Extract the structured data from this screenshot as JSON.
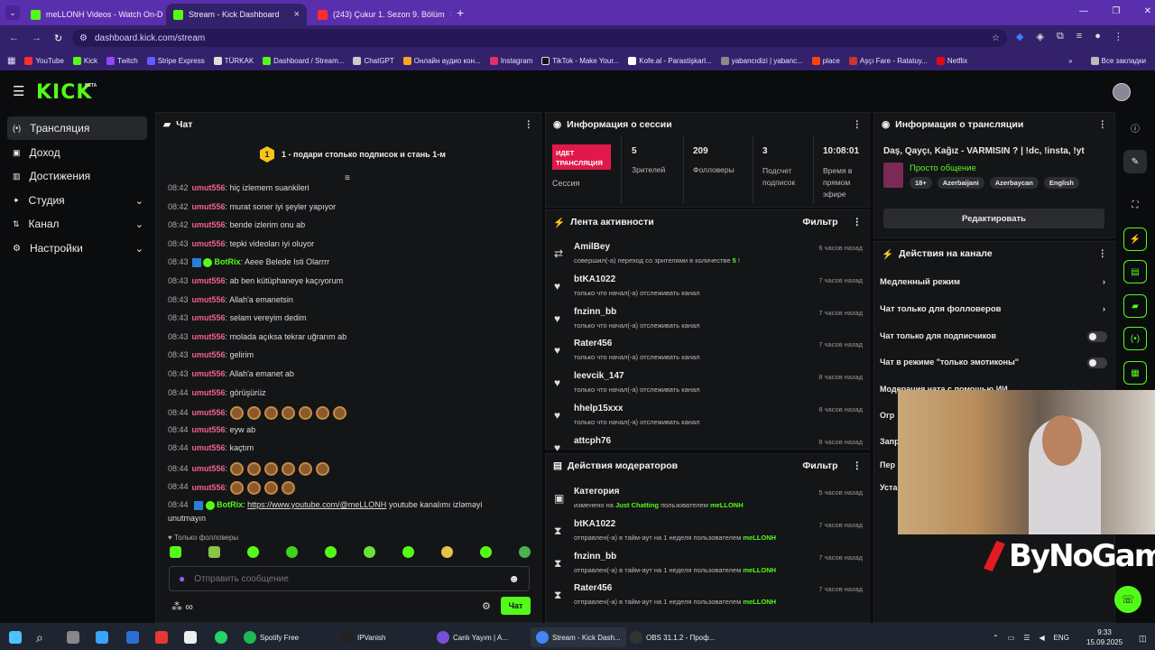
{
  "browser": {
    "tabs": [
      {
        "title": "meLLONH Videos - Watch On-D"
      },
      {
        "title": "Stream - Kick Dashboard"
      },
      {
        "title": "(243) Çukur 1. Sezon 9. Bölüm"
      }
    ],
    "url": "dashboard.kick.com/stream",
    "bookmarks": [
      "YouTube",
      "Kick",
      "Twitch",
      "Stripe Express",
      "TÜRKAK",
      "Dashboard / Stream...",
      "ChatGPT",
      "Онлайн аудио кон...",
      "Instagram",
      "TikTok - Make Your...",
      "Kofe.al - Parastişkarl...",
      "yabancıdizi | yabanc...",
      "place",
      "Aşçı Fare - Ratatuy...",
      "Netflix"
    ],
    "all_bookmarks": "Все закладки"
  },
  "kick": {
    "logo": "KICK",
    "beta": "BETA",
    "sidebar": [
      {
        "label": "Трансляция"
      },
      {
        "label": "Доход"
      },
      {
        "label": "Достижения"
      },
      {
        "label": "Студия"
      },
      {
        "label": "Канал"
      },
      {
        "label": "Настройки"
      }
    ]
  },
  "chat": {
    "title": "Чат",
    "pinned_rank": "1",
    "pinned": "1 - подари столько подписок и стань 1-м",
    "lines": [
      {
        "time": "08:42",
        "user": "umut556",
        "msg": "hiç izlemem suankileri"
      },
      {
        "time": "08:42",
        "user": "umut556",
        "msg": "murat soner iyi şeyler yapıyor"
      },
      {
        "time": "08:42",
        "user": "umut556",
        "msg": "bende izlerim onu ab"
      },
      {
        "time": "08:43",
        "user": "umut556",
        "msg": "tepki videoları iyi oluyor"
      },
      {
        "time": "08:43",
        "user": "BotRix",
        "msg": "Aeee Belede Isti Olarrrr"
      },
      {
        "time": "08:43",
        "user": "umut556",
        "msg": "ab ben kütüphaneye kaçıyorum"
      },
      {
        "time": "08:43",
        "user": "umut556",
        "msg": "Allah'a emanetsin"
      },
      {
        "time": "08:43",
        "user": "umut556",
        "msg": "selam vereyim dedim"
      },
      {
        "time": "08:43",
        "user": "umut556",
        "msg": "molada açıksa tekrar uğrarım ab"
      },
      {
        "time": "08:43",
        "user": "umut556",
        "msg": "gelirim"
      },
      {
        "time": "08:43",
        "user": "umut556",
        "msg": "Allah'a emanet ab"
      },
      {
        "time": "08:44",
        "user": "umut556",
        "msg": "görüşürüz"
      },
      {
        "time": "08:44",
        "user": "umut556",
        "msg": ""
      },
      {
        "time": "08:44",
        "user": "umut556",
        "msg": "eyw ab"
      },
      {
        "time": "08:44",
        "user": "umut556",
        "msg": "kaçtım"
      },
      {
        "time": "08:44",
        "user": "umut556",
        "msg": ""
      },
      {
        "time": "08:44",
        "user": "umut556",
        "msg": ""
      }
    ],
    "last_time": "08:44",
    "last_user": "BotRix",
    "last_link": "https://www.youtube.com/@meLLONH",
    "last_msg": "youtube kanalımı izləməyi",
    "last_msg2": "unutmayın",
    "followers_only": "Только фолловеры",
    "input_placeholder": "Отправить сообщение",
    "send": "Чат"
  },
  "session": {
    "title": "Информация о сессии",
    "live": "ИДЕТ ТРАНСЛЯЦИЯ",
    "session_label": "Сессия",
    "viewers": "5",
    "viewers_label": "Зрителей",
    "followers": "209",
    "followers_label": "Фолловеры",
    "subs": "3",
    "subs_label": "Подсчет подписок",
    "uptime": "10:08:01",
    "uptime_label": "Время в прямом эфире"
  },
  "activity": {
    "title": "Лента активности",
    "filter": "Фильтр",
    "items": [
      {
        "name": "AmilBey",
        "desc": "совершил(-а) переход со зрителями в количестве",
        "num": "5",
        "time": "6 часов назад",
        "icon": "raid"
      },
      {
        "name": "btKA1022",
        "desc": "только что начал(-а) отслеживать канал",
        "time": "7 часов назад",
        "icon": "heart"
      },
      {
        "name": "fnzinn_bb",
        "desc": "только что начал(-а) отслеживать канал",
        "time": "7 часов назад",
        "icon": "heart"
      },
      {
        "name": "Rater456",
        "desc": "только что начал(-а) отслеживать канал",
        "time": "7 часов назад",
        "icon": "heart"
      },
      {
        "name": "leevcik_147",
        "desc": "только что начал(-а) отслеживать канал",
        "time": "8 часов назад",
        "icon": "heart"
      },
      {
        "name": "hhelp15xxx",
        "desc": "только что начал(-а) отслеживать канал",
        "time": "8 часов назад",
        "icon": "heart"
      },
      {
        "name": "attcph76",
        "desc": "",
        "time": "8 часов назад",
        "icon": "heart"
      }
    ]
  },
  "mod": {
    "title": "Действия модераторов",
    "filter": "Фильтр",
    "items": [
      {
        "name": "Категория",
        "pre": "изменено на",
        "cat": "Just Chatting",
        "mid": "пользователем",
        "by": "meLLONH",
        "time": "5 часов назад"
      },
      {
        "name": "btKA1022",
        "pre": "отправлен(-а) в тайм-аут на 1 неделя пользователем",
        "by": "meLLONH",
        "time": "7 часов назад"
      },
      {
        "name": "fnzinn_bb",
        "pre": "отправлен(-а) в тайм-аут на 1 неделя пользователем",
        "by": "meLLONH",
        "time": "7 часов назад"
      },
      {
        "name": "Rater456",
        "pre": "отправлен(-а) в тайм-аут на 1 неделя пользователем",
        "by": "meLLONH",
        "time": "7 часов назад"
      }
    ]
  },
  "stream": {
    "title": "Информация о трансляции",
    "name": "Daş, Qayçı, Kağız - VARMISIN ? | !dc, !insta, !yt",
    "category": "Просто общение",
    "tags": [
      "18+",
      "Azerbaijani",
      "Azerbaycan",
      "English"
    ],
    "edit": "Редактировать"
  },
  "channel": {
    "title": "Действия на канале",
    "items": [
      "Медленный режим",
      "Чат только для фолловеров",
      "Чат только для подписчиков",
      "Чат в режиме \"только эмотиконы\"",
      "Модерация чата с помощью ИИ",
      "Огр",
      "Запр",
      "Пер",
      "Уста"
    ]
  },
  "overlay": {
    "brand": "ByNoGame"
  },
  "taskbar": {
    "apps": [
      "Spotify Free",
      "IPVanish",
      "Canlı Yayım | A...",
      "Stream - Kick Dash...",
      "OBS 31.1.2 - Проф..."
    ],
    "lang": "ENG",
    "time": "9:33",
    "date": "15.09.2025"
  },
  "colors": {
    "accent": "#53fc18",
    "live": "#e0194a",
    "browser": "#5a2fae"
  }
}
